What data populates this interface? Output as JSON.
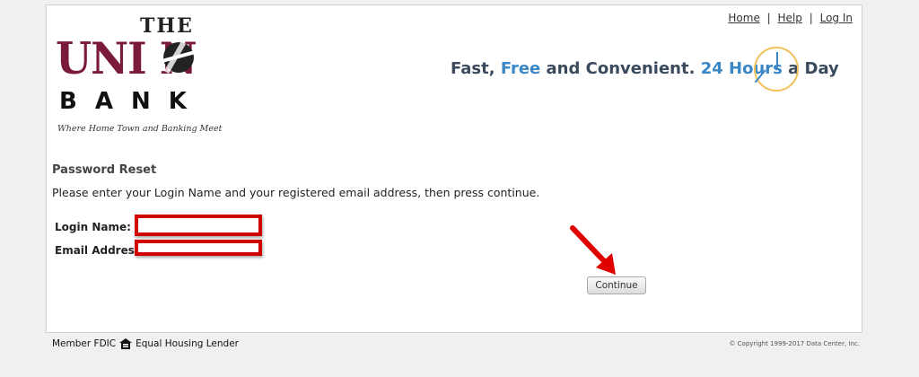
{
  "nav": {
    "home": "Home",
    "help": "Help",
    "login": "Log In",
    "separator": "|"
  },
  "logo": {
    "the": "THE",
    "union": "UNI  N",
    "bank": "BANK",
    "tagline": "Where Home Town and Banking Meet"
  },
  "slogan": {
    "part1": "Fast, ",
    "free": "Free",
    "part2": " and Convenient. ",
    "hours": "24 Hours",
    "part3": " a Day"
  },
  "form": {
    "title": "Password Reset",
    "instructions": "Please enter your Login Name and your registered email address, then press continue.",
    "login_label": "Login Name:",
    "login_value": "",
    "email_label": "Email Address:",
    "email_value": "",
    "continue_label": "Continue"
  },
  "footer": {
    "member": "Member FDIC",
    "equal_housing": "Equal Housing Lender",
    "copyright": "© Copyright 1999-2017 Data Center, Inc."
  },
  "colors": {
    "accent_red": "#d00000",
    "brand_maroon": "#7a1b3c",
    "slogan_blue": "#3b87c6"
  }
}
